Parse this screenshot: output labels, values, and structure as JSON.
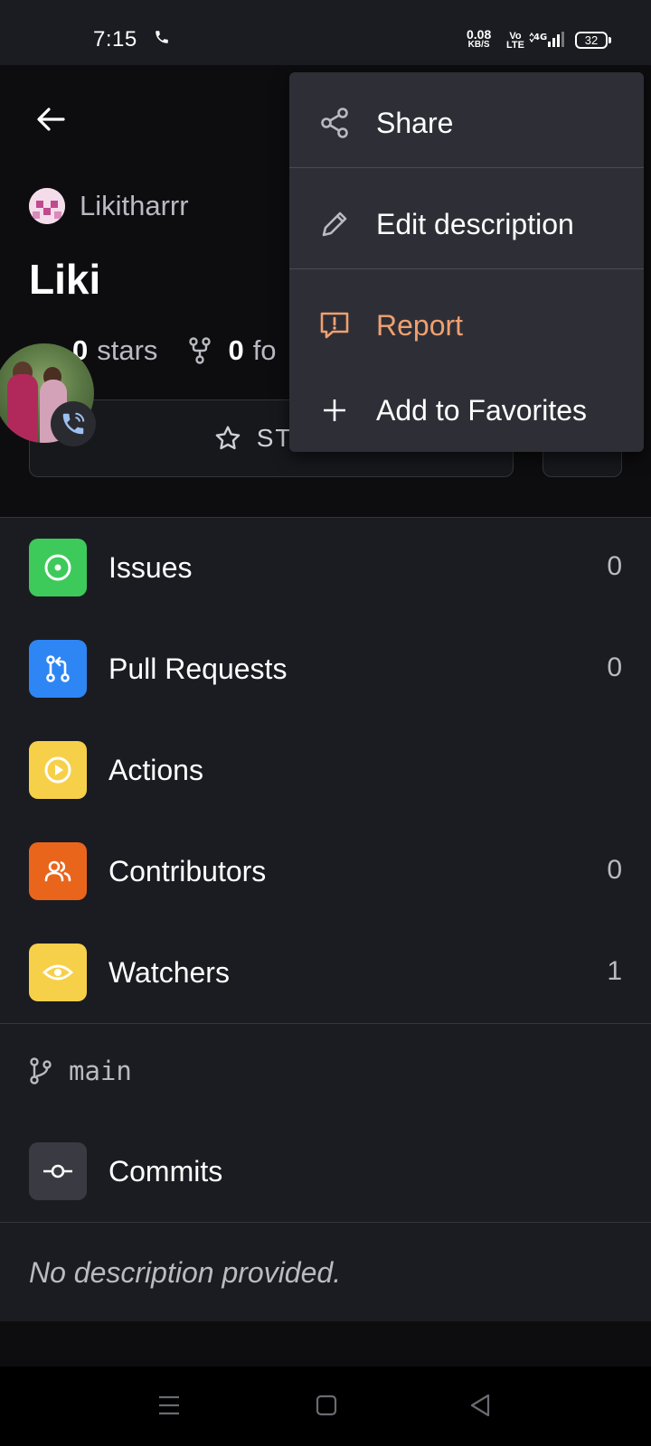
{
  "status_bar": {
    "time": "7:15",
    "net_speed": "0.08",
    "net_unit": "KB/S",
    "volte_top": "Vo",
    "volte_bottom": "LTE",
    "signal_label": "4G",
    "battery": "32"
  },
  "repo": {
    "owner": "Likitharrr",
    "name": "Liki",
    "stars_count": "0",
    "stars_label": "stars",
    "forks_count": "0",
    "forks_label": "fo",
    "star_button": "STAR"
  },
  "menu": {
    "items": [
      {
        "label": "Share",
        "icon": "share-icon"
      },
      {
        "label": "Edit description",
        "icon": "pencil-icon"
      },
      {
        "label": "Report",
        "icon": "report-icon",
        "color": "#f0a070"
      },
      {
        "label": "Add to Favorites",
        "icon": "plus-icon"
      }
    ]
  },
  "list": {
    "items": [
      {
        "label": "Issues",
        "count": "0",
        "icon": "issue-icon",
        "color": "#3ec95b"
      },
      {
        "label": "Pull Requests",
        "count": "0",
        "icon": "pull-request-icon",
        "color": "#2e86f5"
      },
      {
        "label": "Actions",
        "count": "",
        "icon": "play-icon",
        "color": "#f7d04a"
      },
      {
        "label": "Contributors",
        "count": "0",
        "icon": "people-icon",
        "color": "#e9651c"
      },
      {
        "label": "Watchers",
        "count": "1",
        "icon": "eye-icon",
        "color": "#f7d04a"
      }
    ],
    "branch": "main",
    "commits_label": "Commits"
  },
  "description": "No description provided."
}
